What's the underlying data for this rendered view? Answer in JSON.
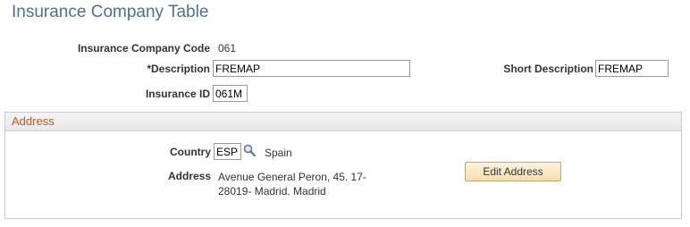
{
  "page": {
    "title": "Insurance Company Table"
  },
  "form": {
    "code_label": "Insurance Company Code",
    "code_value": "061",
    "description_label": "*Description",
    "description_value": "FREMAP",
    "short_description_label": "Short Description",
    "short_description_value": "FREMAP",
    "insurance_id_label": "Insurance ID",
    "insurance_id_value": "061M"
  },
  "address_section": {
    "title": "Address",
    "country_label": "Country",
    "country_code": "ESP",
    "country_name": "Spain",
    "address_label": "Address",
    "address_text": "Avenue General Peron, 45. 17-\n28019- Madrid. Madrid",
    "edit_address_label": "Edit Address"
  },
  "icons": {
    "country_lookup": "magnifier-icon"
  }
}
